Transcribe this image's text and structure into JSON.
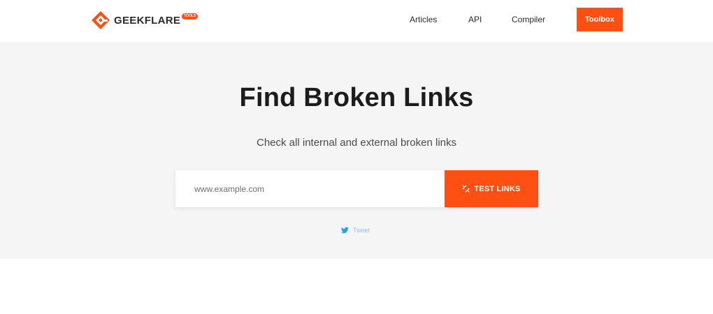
{
  "header": {
    "logo_text": "GEEKFLARE",
    "logo_badge": "TOOLS",
    "nav": {
      "articles": "Articles",
      "api": "API",
      "compiler": "Compiler"
    },
    "toolbox_label": "Toolbox"
  },
  "hero": {
    "title": "Find Broken Links",
    "subtitle": "Check all internal and external broken links"
  },
  "search": {
    "placeholder": "www.example.com",
    "value": "",
    "button_label": "TEST LINKS",
    "button_icon": "unlink-icon"
  },
  "social": {
    "tweet_label": "Tweet",
    "tweet_icon": "twitter-bird-icon"
  },
  "colors": {
    "accent": "#ff4f12",
    "hero_bg": "#f5f5f5",
    "twitter": "#1da1f2"
  }
}
